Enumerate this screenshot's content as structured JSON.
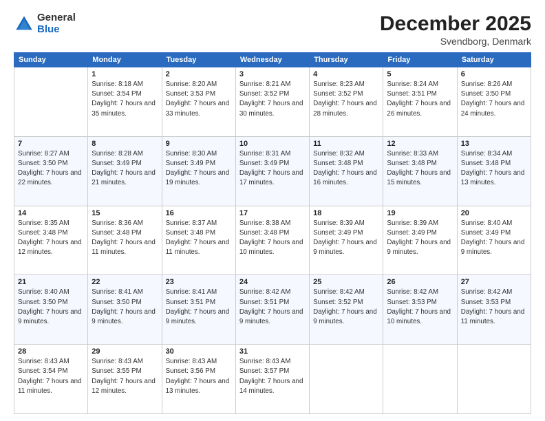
{
  "header": {
    "logo_general": "General",
    "logo_blue": "Blue",
    "month": "December 2025",
    "location": "Svendborg, Denmark"
  },
  "weekdays": [
    "Sunday",
    "Monday",
    "Tuesday",
    "Wednesday",
    "Thursday",
    "Friday",
    "Saturday"
  ],
  "weeks": [
    [
      {
        "day": "",
        "empty": true
      },
      {
        "day": "1",
        "sunrise": "Sunrise: 8:18 AM",
        "sunset": "Sunset: 3:54 PM",
        "daylight": "Daylight: 7 hours and 35 minutes."
      },
      {
        "day": "2",
        "sunrise": "Sunrise: 8:20 AM",
        "sunset": "Sunset: 3:53 PM",
        "daylight": "Daylight: 7 hours and 33 minutes."
      },
      {
        "day": "3",
        "sunrise": "Sunrise: 8:21 AM",
        "sunset": "Sunset: 3:52 PM",
        "daylight": "Daylight: 7 hours and 30 minutes."
      },
      {
        "day": "4",
        "sunrise": "Sunrise: 8:23 AM",
        "sunset": "Sunset: 3:52 PM",
        "daylight": "Daylight: 7 hours and 28 minutes."
      },
      {
        "day": "5",
        "sunrise": "Sunrise: 8:24 AM",
        "sunset": "Sunset: 3:51 PM",
        "daylight": "Daylight: 7 hours and 26 minutes."
      },
      {
        "day": "6",
        "sunrise": "Sunrise: 8:26 AM",
        "sunset": "Sunset: 3:50 PM",
        "daylight": "Daylight: 7 hours and 24 minutes."
      }
    ],
    [
      {
        "day": "7",
        "sunrise": "Sunrise: 8:27 AM",
        "sunset": "Sunset: 3:50 PM",
        "daylight": "Daylight: 7 hours and 22 minutes."
      },
      {
        "day": "8",
        "sunrise": "Sunrise: 8:28 AM",
        "sunset": "Sunset: 3:49 PM",
        "daylight": "Daylight: 7 hours and 21 minutes."
      },
      {
        "day": "9",
        "sunrise": "Sunrise: 8:30 AM",
        "sunset": "Sunset: 3:49 PM",
        "daylight": "Daylight: 7 hours and 19 minutes."
      },
      {
        "day": "10",
        "sunrise": "Sunrise: 8:31 AM",
        "sunset": "Sunset: 3:49 PM",
        "daylight": "Daylight: 7 hours and 17 minutes."
      },
      {
        "day": "11",
        "sunrise": "Sunrise: 8:32 AM",
        "sunset": "Sunset: 3:48 PM",
        "daylight": "Daylight: 7 hours and 16 minutes."
      },
      {
        "day": "12",
        "sunrise": "Sunrise: 8:33 AM",
        "sunset": "Sunset: 3:48 PM",
        "daylight": "Daylight: 7 hours and 15 minutes."
      },
      {
        "day": "13",
        "sunrise": "Sunrise: 8:34 AM",
        "sunset": "Sunset: 3:48 PM",
        "daylight": "Daylight: 7 hours and 13 minutes."
      }
    ],
    [
      {
        "day": "14",
        "sunrise": "Sunrise: 8:35 AM",
        "sunset": "Sunset: 3:48 PM",
        "daylight": "Daylight: 7 hours and 12 minutes."
      },
      {
        "day": "15",
        "sunrise": "Sunrise: 8:36 AM",
        "sunset": "Sunset: 3:48 PM",
        "daylight": "Daylight: 7 hours and 11 minutes."
      },
      {
        "day": "16",
        "sunrise": "Sunrise: 8:37 AM",
        "sunset": "Sunset: 3:48 PM",
        "daylight": "Daylight: 7 hours and 11 minutes."
      },
      {
        "day": "17",
        "sunrise": "Sunrise: 8:38 AM",
        "sunset": "Sunset: 3:48 PM",
        "daylight": "Daylight: 7 hours and 10 minutes."
      },
      {
        "day": "18",
        "sunrise": "Sunrise: 8:39 AM",
        "sunset": "Sunset: 3:49 PM",
        "daylight": "Daylight: 7 hours and 9 minutes."
      },
      {
        "day": "19",
        "sunrise": "Sunrise: 8:39 AM",
        "sunset": "Sunset: 3:49 PM",
        "daylight": "Daylight: 7 hours and 9 minutes."
      },
      {
        "day": "20",
        "sunrise": "Sunrise: 8:40 AM",
        "sunset": "Sunset: 3:49 PM",
        "daylight": "Daylight: 7 hours and 9 minutes."
      }
    ],
    [
      {
        "day": "21",
        "sunrise": "Sunrise: 8:40 AM",
        "sunset": "Sunset: 3:50 PM",
        "daylight": "Daylight: 7 hours and 9 minutes."
      },
      {
        "day": "22",
        "sunrise": "Sunrise: 8:41 AM",
        "sunset": "Sunset: 3:50 PM",
        "daylight": "Daylight: 7 hours and 9 minutes."
      },
      {
        "day": "23",
        "sunrise": "Sunrise: 8:41 AM",
        "sunset": "Sunset: 3:51 PM",
        "daylight": "Daylight: 7 hours and 9 minutes."
      },
      {
        "day": "24",
        "sunrise": "Sunrise: 8:42 AM",
        "sunset": "Sunset: 3:51 PM",
        "daylight": "Daylight: 7 hours and 9 minutes."
      },
      {
        "day": "25",
        "sunrise": "Sunrise: 8:42 AM",
        "sunset": "Sunset: 3:52 PM",
        "daylight": "Daylight: 7 hours and 9 minutes."
      },
      {
        "day": "26",
        "sunrise": "Sunrise: 8:42 AM",
        "sunset": "Sunset: 3:53 PM",
        "daylight": "Daylight: 7 hours and 10 minutes."
      },
      {
        "day": "27",
        "sunrise": "Sunrise: 8:42 AM",
        "sunset": "Sunset: 3:53 PM",
        "daylight": "Daylight: 7 hours and 11 minutes."
      }
    ],
    [
      {
        "day": "28",
        "sunrise": "Sunrise: 8:43 AM",
        "sunset": "Sunset: 3:54 PM",
        "daylight": "Daylight: 7 hours and 11 minutes."
      },
      {
        "day": "29",
        "sunrise": "Sunrise: 8:43 AM",
        "sunset": "Sunset: 3:55 PM",
        "daylight": "Daylight: 7 hours and 12 minutes."
      },
      {
        "day": "30",
        "sunrise": "Sunrise: 8:43 AM",
        "sunset": "Sunset: 3:56 PM",
        "daylight": "Daylight: 7 hours and 13 minutes."
      },
      {
        "day": "31",
        "sunrise": "Sunrise: 8:43 AM",
        "sunset": "Sunset: 3:57 PM",
        "daylight": "Daylight: 7 hours and 14 minutes."
      },
      {
        "day": "",
        "empty": true
      },
      {
        "day": "",
        "empty": true
      },
      {
        "day": "",
        "empty": true
      }
    ]
  ]
}
